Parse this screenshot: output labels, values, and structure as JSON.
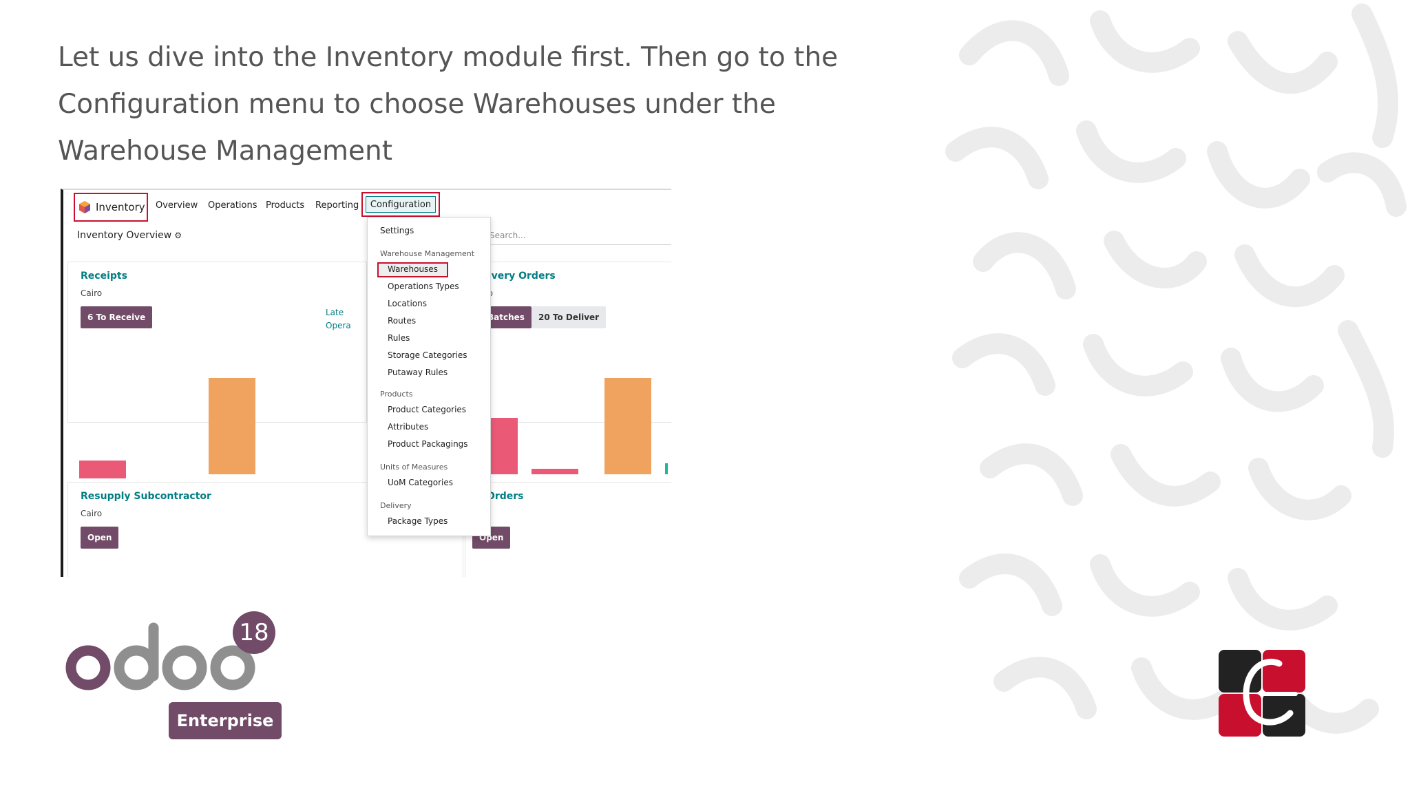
{
  "slide": {
    "lines": [
      "Let us dive into the Inventory module first. Then go to the",
      "Configuration menu to choose Warehouses under the",
      "Warehouse Management"
    ]
  },
  "app": {
    "name": "Inventory",
    "menu": [
      "Overview",
      "Operations",
      "Products",
      "Reporting"
    ],
    "active_menu": "Configuration"
  },
  "overview": {
    "breadcrumb": "Inventory Overview",
    "search_placeholder": "Search..."
  },
  "cards": {
    "receipts": {
      "title": "Receipts",
      "sub": "Cairo",
      "button": "6 To Receive",
      "late": "Late",
      "late2": "Opera"
    },
    "delivery": {
      "title": "livery Orders",
      "sub": "ro",
      "button": "Batches",
      "button2": "20 To Deliver"
    },
    "resupply": {
      "title": "Resupply Subcontractor",
      "sub": "Cairo",
      "button": "Open"
    },
    "sorders": {
      "title": "S Orders",
      "sub": "ro",
      "button": "Open"
    }
  },
  "dropdown": {
    "settings": "Settings",
    "warehouse_header": "Warehouse Management",
    "warehouse_items": [
      "Warehouses",
      "Operations Types",
      "Locations",
      "Routes",
      "Rules",
      "Storage Categories",
      "Putaway Rules"
    ],
    "products_header": "Products",
    "products_items": [
      "Product Categories",
      "Attributes",
      "Product Packagings"
    ],
    "uom_header": "Units of Measures",
    "uom_items": [
      "UoM Categories"
    ],
    "delivery_header": "Delivery",
    "delivery_items": [
      "Package Types"
    ]
  },
  "branding": {
    "version": "18",
    "edition": "Enterprise"
  },
  "colors": {
    "odoo_purple": "#714b67",
    "teal": "#017e84",
    "highlight_red": "#c8102e",
    "bar_pink": "#ea5a77",
    "bar_orange": "#f0a35e"
  }
}
